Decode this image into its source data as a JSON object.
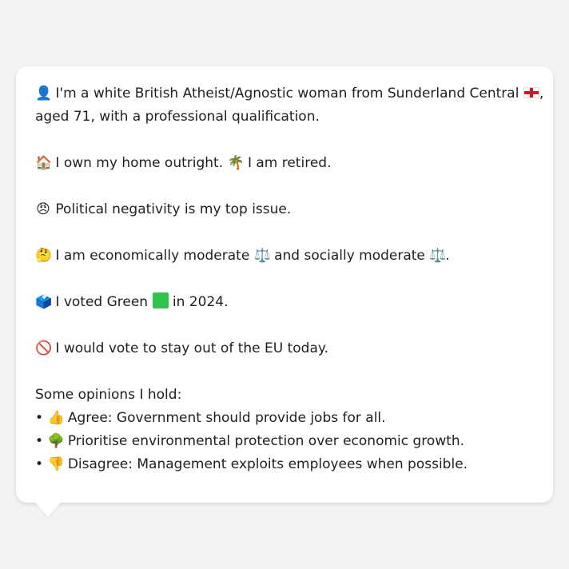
{
  "profile": {
    "intro_icon": "person-silhouette",
    "intro_text_1": "I'm a white British Atheist/Agnostic woman from Sunderland Central",
    "intro_flag_icon": "england-flag",
    "intro_text_2": ",",
    "intro_text_3": "aged 71, with a professional qualification.",
    "home_icon": "house",
    "home_text": "I own my home outright.",
    "retired_icon": "palm-tree",
    "retired_text": "I am retired.",
    "issue_icon": "angry-face",
    "issue_text": "Political negativity is my top issue.",
    "econ_icon": "thinking-face",
    "econ_text_1": "I am economically moderate",
    "econ_scale_icon": "balance-scale",
    "econ_text_2": "and socially moderate",
    "econ_text_3": ".",
    "vote_icon": "ballot-box",
    "vote_text_1": "I voted Green",
    "vote_green_icon": "green-square",
    "vote_text_2": "in 2024.",
    "eu_icon": "prohibited",
    "eu_text": "I would vote to stay out of the EU today."
  },
  "opinions": {
    "heading": "Some opinions I hold:",
    "bullet": "•",
    "items": [
      {
        "icon": "thumbs-up",
        "glyph": "👍",
        "text": "Agree: Government should provide jobs for all."
      },
      {
        "icon": "tree",
        "glyph": "🌳",
        "text": "Prioritise environmental protection over economic growth."
      },
      {
        "icon": "thumbs-down",
        "glyph": "👎",
        "text": "Disagree: Management exploits employees when possible."
      }
    ]
  },
  "glyphs": {
    "person": "👤",
    "house": "🏠",
    "palm": "🌴",
    "angry": "😠",
    "thinking": "🤔",
    "scale": "⚖️",
    "ballot": "🗳️",
    "prohibited": "🚫"
  },
  "colors": {
    "background": "#f2f3f5",
    "bubble": "#ffffff",
    "text": "#1f1f1f",
    "green_square": "#2ec44a",
    "flag_red": "#d0142a"
  }
}
